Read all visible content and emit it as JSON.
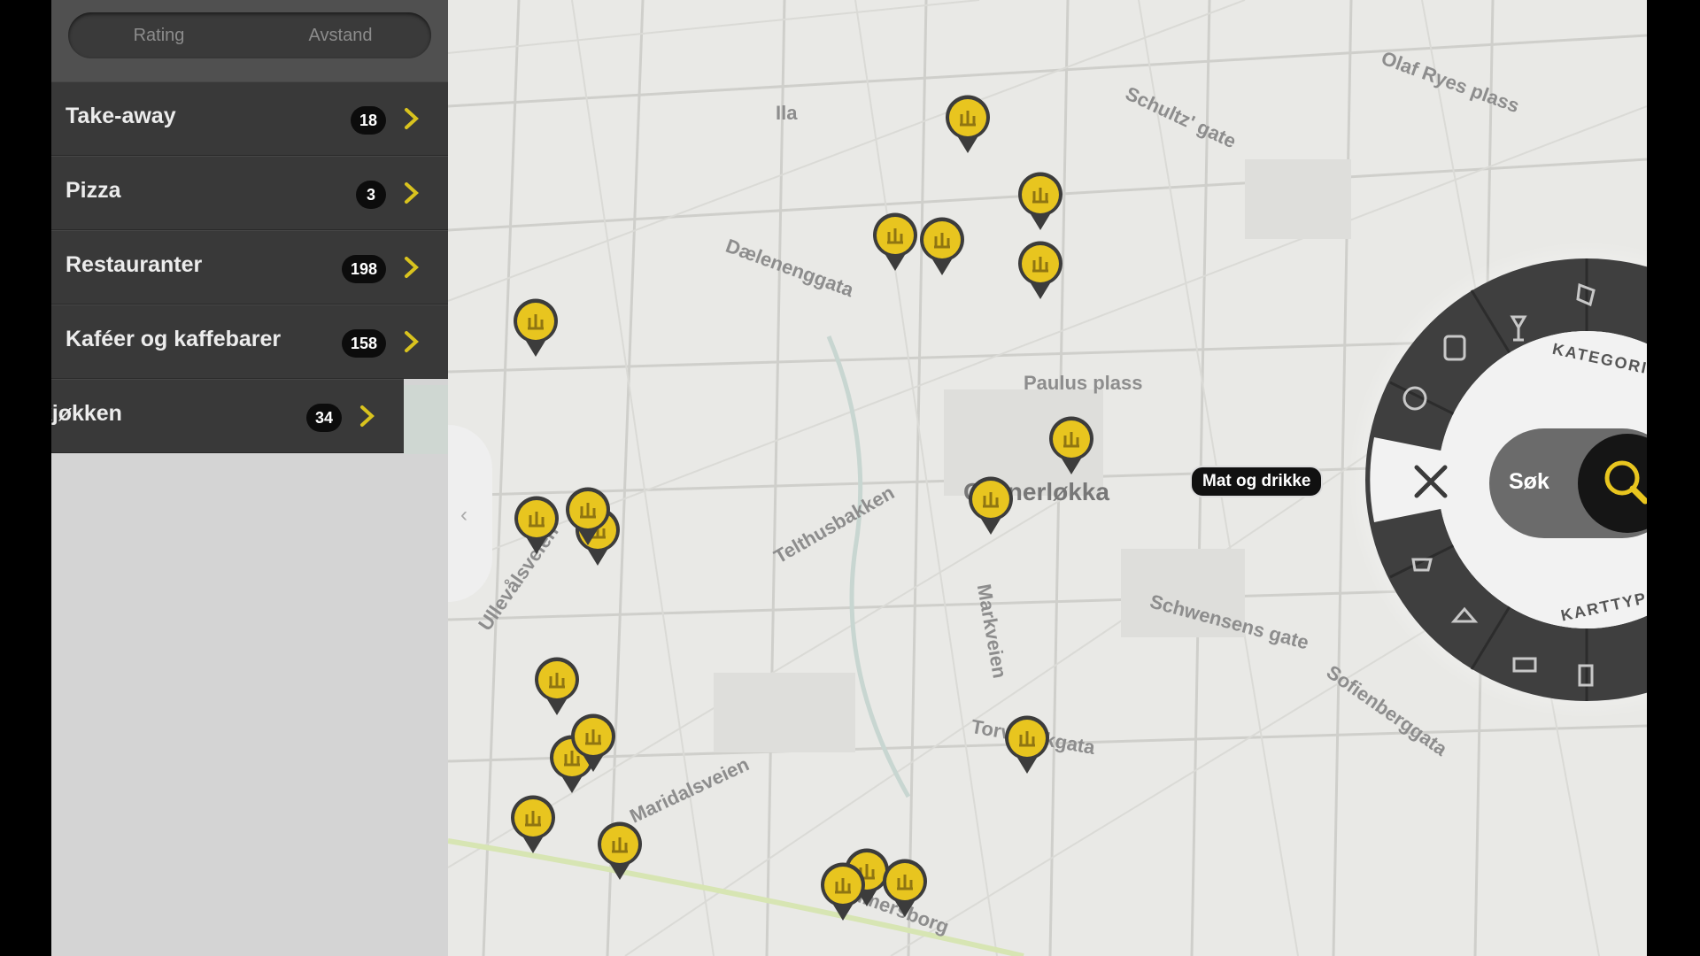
{
  "tabs": [
    {
      "label": "Rating"
    },
    {
      "label": "Avstand"
    }
  ],
  "categories": [
    {
      "label": "Take-away",
      "count": "18"
    },
    {
      "label": "Pizza",
      "count": "3"
    },
    {
      "label": "Restauranter",
      "count": "198"
    },
    {
      "label": "Kaféer og kaffebarer",
      "count": "158"
    },
    {
      "label": "lekjøkken",
      "count": "34"
    }
  ],
  "map": {
    "street_labels": [
      "Paulus plass",
      "Telthusbakken",
      "Schwensens gate",
      "Torvbakkgata",
      "Hammersborg",
      "Maridalsveien",
      "Schultz' gate",
      "Olaf Ryes plass",
      "Sofienberggata",
      "Markveien",
      "Dælenenggata",
      "Ullevålsveien",
      "Ila"
    ],
    "district_label": "Grünerløkka"
  },
  "wheel": {
    "selected_category": "Mat og drikke",
    "search_label": "Søk",
    "arc_top": "KATEGORIER",
    "arc_bottom": "KARTTYPE"
  },
  "colors": {
    "accent": "#e8c51f",
    "panel_dark": "#393939",
    "panel_bg": "#d4d4d4"
  }
}
